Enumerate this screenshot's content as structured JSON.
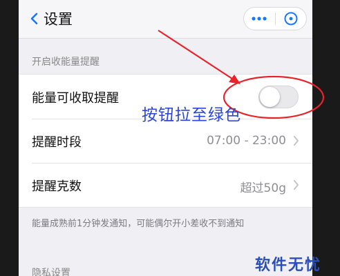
{
  "nav": {
    "back_label": "设置"
  },
  "sections": [
    {
      "header": "开启收能量提醒",
      "rows": [
        {
          "label": "能量可收取提醒",
          "toggle_on": false
        },
        {
          "label": "提醒时段",
          "value": "07:00 - 23:00"
        },
        {
          "label": "提醒克数",
          "value": "超过50g"
        }
      ],
      "footnote": "能量成熟前1分钟发通知，可能偶尔开小差收不到通知"
    },
    {
      "header": "隐私设置"
    }
  ],
  "annotation": {
    "text": "按钮拉至绿色",
    "color": "#2b45d8",
    "mark_color": "#e8242a"
  },
  "watermark": {
    "text": "软件无忧"
  }
}
